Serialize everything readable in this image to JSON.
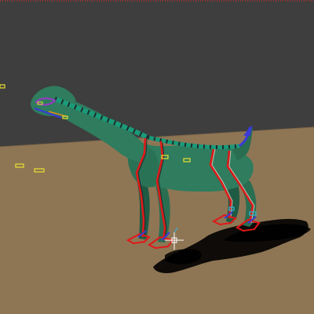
{
  "viewport": {
    "label": "",
    "colors": {
      "background": "#3e3e3e",
      "floor": "#8e7655",
      "floor_edge": "#7b6549",
      "shadow": "#000000",
      "top_marker": "#ff2a2a",
      "skin": "#2f7c5e",
      "skin_dark": "#1f5a44",
      "spine": "#1a9a78",
      "bone_dark": "#202a2a",
      "leg_ik": "#e01818",
      "ik_handle": "#c9c0b0",
      "control_blue": "#3a3ad8",
      "control_purple": "#9a39c8",
      "control_yellow": "#e8e030",
      "control_orange": "#e08a1a",
      "control_cyan": "#29b9d9",
      "selected_white": "#ffffff"
    }
  },
  "scene": {
    "subject": "dinosaur-rig",
    "control_icons": [
      "yellow-locator-icon",
      "ik-foot-control-icon",
      "manipulator-cross-icon"
    ]
  }
}
